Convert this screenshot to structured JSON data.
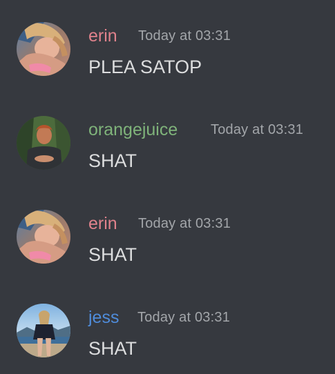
{
  "messages": [
    {
      "username": "erin",
      "username_color": "#e0828c",
      "timestamp": "Today at 03:31",
      "text": "PLEA SATOP",
      "avatar": "erin-avatar"
    },
    {
      "username": "orangejuice",
      "username_color": "#7fb37a",
      "timestamp": "Today at 03:31",
      "text": "SHAT",
      "avatar": "orangejuice-avatar"
    },
    {
      "username": "erin",
      "username_color": "#e0828c",
      "timestamp": "Today at 03:31",
      "text": "SHAT",
      "avatar": "erin-avatar"
    },
    {
      "username": "jess",
      "username_color": "#4f8cdb",
      "timestamp": "Today at 03:31",
      "text": "SHAT",
      "avatar": "jess-avatar"
    }
  ],
  "colors": {
    "background": "#36393f",
    "timestamp": "#a3a6aa",
    "text": "#dcddde"
  }
}
